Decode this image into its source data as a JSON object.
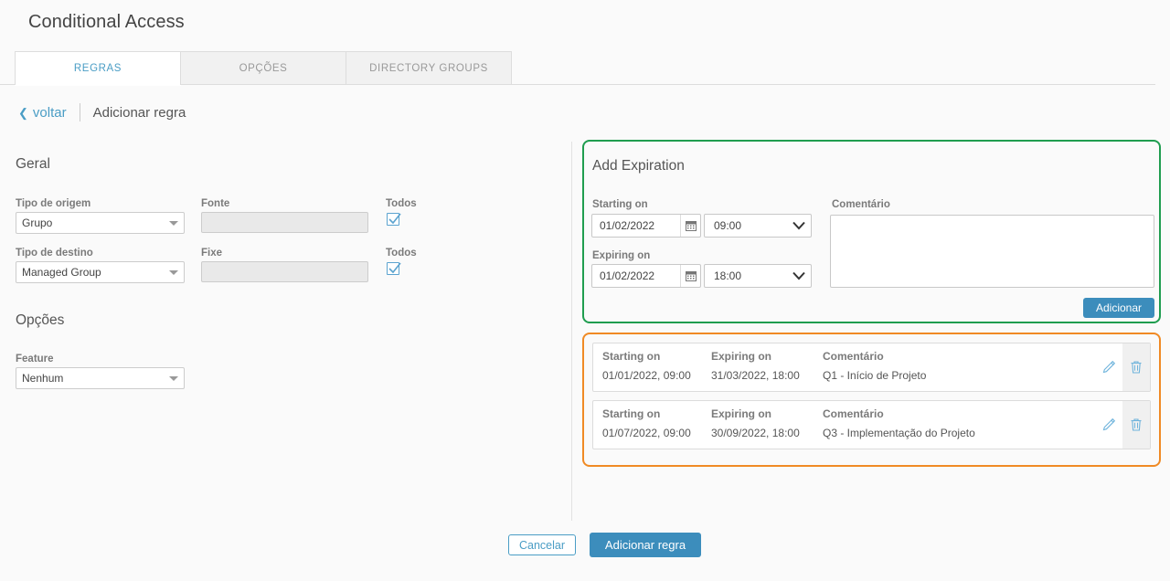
{
  "header": {
    "title": "Conditional Access"
  },
  "tabs": [
    {
      "label": "REGRAS",
      "active": true
    },
    {
      "label": "OPÇÕES",
      "active": false
    },
    {
      "label": "DIRECTORY GROUPS",
      "active": false
    }
  ],
  "breadcrumb": {
    "back_label": "voltar",
    "current": "Adicionar regra"
  },
  "left": {
    "general_title": "Geral",
    "options_title": "Opções",
    "fields": {
      "source_type_label": "Tipo de origem",
      "source_type_value": "Grupo",
      "font_label": "Fonte",
      "font_value": "",
      "all_1_label": "Todos",
      "dest_type_label": "Tipo de destino",
      "dest_type_value": "Managed Group",
      "fixed_label": "Fixe",
      "fixed_value": "",
      "all_2_label": "Todos",
      "feature_label": "Feature",
      "feature_value": "Nenhum"
    }
  },
  "add_expiration": {
    "title": "Add Expiration",
    "starting_label": "Starting on",
    "starting_date": "01/02/2022",
    "starting_time": "09:00",
    "expiring_label": "Expiring on",
    "expiring_date": "01/02/2022",
    "expiring_time": "18:00",
    "comment_label": "Comentário",
    "comment_value": "",
    "add_button": "Adicionar",
    "border_color": "#1f9d4f"
  },
  "expiration_list": {
    "border_color": "#f08a24",
    "columns": {
      "starting": "Starting on",
      "expiring": "Expiring on",
      "comment": "Comentário"
    },
    "rows": [
      {
        "starting": "01/01/2022, 09:00",
        "expiring": "31/03/2022, 18:00",
        "comment": "Q1 - Início de Projeto"
      },
      {
        "starting": "01/07/2022, 09:00",
        "expiring": "30/09/2022, 18:00",
        "comment": "Q3 - Implementação do Projeto"
      }
    ]
  },
  "footer": {
    "cancel_label": "Cancelar",
    "submit_label": "Adicionar regra",
    "primary_color": "#3c8dbc"
  }
}
